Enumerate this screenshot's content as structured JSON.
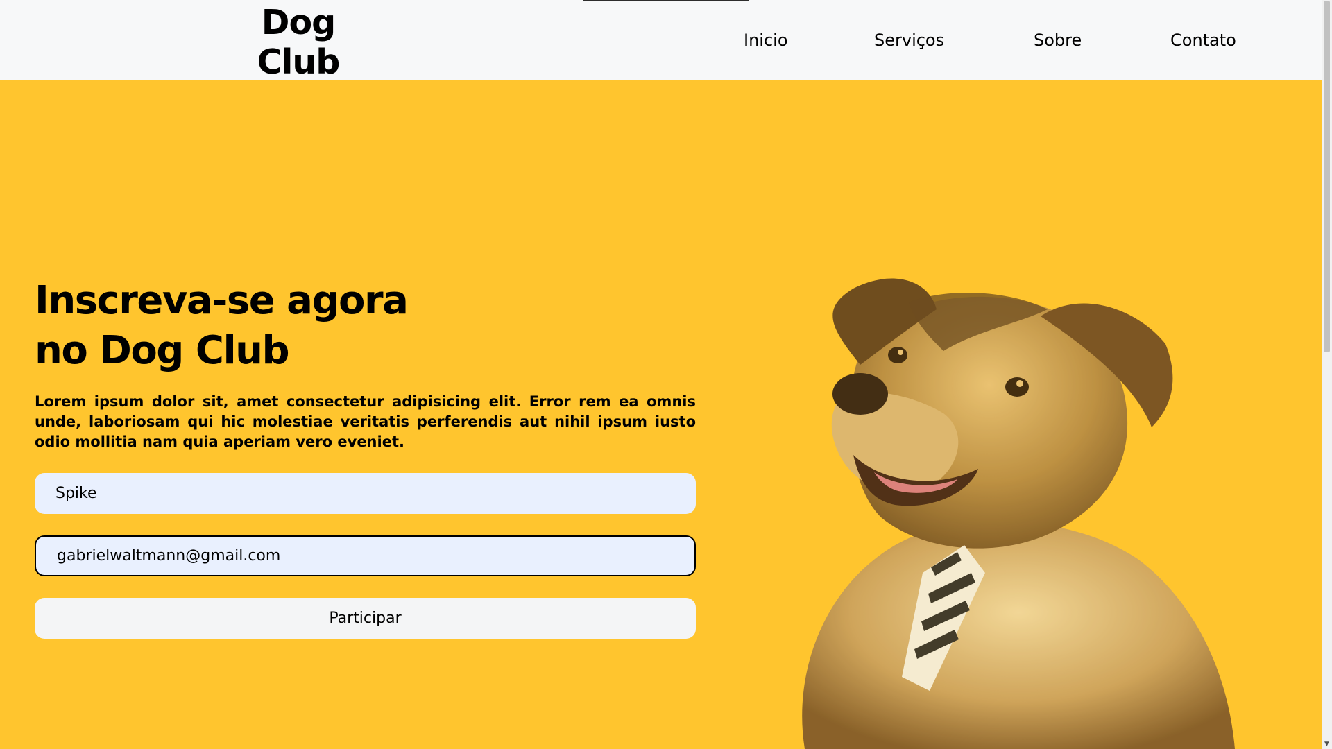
{
  "brand": {
    "name": "Dog Club"
  },
  "nav": {
    "items": [
      {
        "label": "Inicio"
      },
      {
        "label": "Serviços"
      },
      {
        "label": "Sobre"
      },
      {
        "label": "Contato"
      }
    ]
  },
  "hero": {
    "headline_line1": "Inscreva-se agora",
    "headline_line2": "no Dog Club",
    "lead": "Lorem ipsum dolor sit, amet consectetur adipisicing elit. Error rem ea omnis unde, laboriosam qui hic molestiae veritatis perferendis aut nihil ipsum iusto odio mollitia nam quia aperiam vero eveniet."
  },
  "form": {
    "name_value": "Spike",
    "email_value": "gabrielwaltmann@gmail.com",
    "submit_label": "Participar"
  },
  "colors": {
    "hero_background": "#ffc52e",
    "header_background": "#f7f8f9",
    "input_background": "#e9f0fe",
    "button_background": "#f4f5f6",
    "text": "#000000"
  },
  "icons": {
    "scroll_down": "chevron-down-icon"
  }
}
